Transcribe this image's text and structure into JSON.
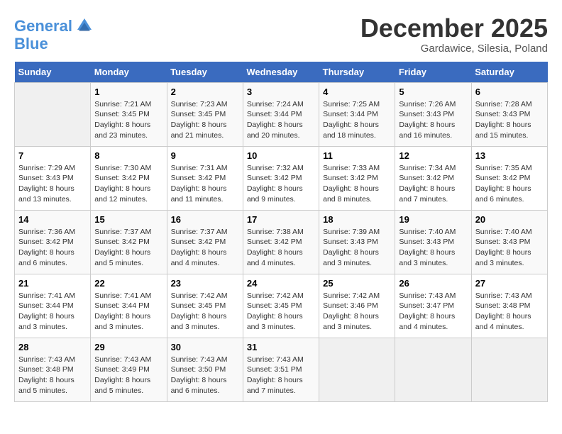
{
  "header": {
    "logo_line1": "General",
    "logo_line2": "Blue",
    "month": "December 2025",
    "location": "Gardawice, Silesia, Poland"
  },
  "weekdays": [
    "Sunday",
    "Monday",
    "Tuesday",
    "Wednesday",
    "Thursday",
    "Friday",
    "Saturday"
  ],
  "weeks": [
    [
      {
        "day": "",
        "info": ""
      },
      {
        "day": "1",
        "info": "Sunrise: 7:21 AM\nSunset: 3:45 PM\nDaylight: 8 hours\nand 23 minutes."
      },
      {
        "day": "2",
        "info": "Sunrise: 7:23 AM\nSunset: 3:45 PM\nDaylight: 8 hours\nand 21 minutes."
      },
      {
        "day": "3",
        "info": "Sunrise: 7:24 AM\nSunset: 3:44 PM\nDaylight: 8 hours\nand 20 minutes."
      },
      {
        "day": "4",
        "info": "Sunrise: 7:25 AM\nSunset: 3:44 PM\nDaylight: 8 hours\nand 18 minutes."
      },
      {
        "day": "5",
        "info": "Sunrise: 7:26 AM\nSunset: 3:43 PM\nDaylight: 8 hours\nand 16 minutes."
      },
      {
        "day": "6",
        "info": "Sunrise: 7:28 AM\nSunset: 3:43 PM\nDaylight: 8 hours\nand 15 minutes."
      }
    ],
    [
      {
        "day": "7",
        "info": "Sunrise: 7:29 AM\nSunset: 3:43 PM\nDaylight: 8 hours\nand 13 minutes."
      },
      {
        "day": "8",
        "info": "Sunrise: 7:30 AM\nSunset: 3:42 PM\nDaylight: 8 hours\nand 12 minutes."
      },
      {
        "day": "9",
        "info": "Sunrise: 7:31 AM\nSunset: 3:42 PM\nDaylight: 8 hours\nand 11 minutes."
      },
      {
        "day": "10",
        "info": "Sunrise: 7:32 AM\nSunset: 3:42 PM\nDaylight: 8 hours\nand 9 minutes."
      },
      {
        "day": "11",
        "info": "Sunrise: 7:33 AM\nSunset: 3:42 PM\nDaylight: 8 hours\nand 8 minutes."
      },
      {
        "day": "12",
        "info": "Sunrise: 7:34 AM\nSunset: 3:42 PM\nDaylight: 8 hours\nand 7 minutes."
      },
      {
        "day": "13",
        "info": "Sunrise: 7:35 AM\nSunset: 3:42 PM\nDaylight: 8 hours\nand 6 minutes."
      }
    ],
    [
      {
        "day": "14",
        "info": "Sunrise: 7:36 AM\nSunset: 3:42 PM\nDaylight: 8 hours\nand 6 minutes."
      },
      {
        "day": "15",
        "info": "Sunrise: 7:37 AM\nSunset: 3:42 PM\nDaylight: 8 hours\nand 5 minutes."
      },
      {
        "day": "16",
        "info": "Sunrise: 7:37 AM\nSunset: 3:42 PM\nDaylight: 8 hours\nand 4 minutes."
      },
      {
        "day": "17",
        "info": "Sunrise: 7:38 AM\nSunset: 3:42 PM\nDaylight: 8 hours\nand 4 minutes."
      },
      {
        "day": "18",
        "info": "Sunrise: 7:39 AM\nSunset: 3:43 PM\nDaylight: 8 hours\nand 3 minutes."
      },
      {
        "day": "19",
        "info": "Sunrise: 7:40 AM\nSunset: 3:43 PM\nDaylight: 8 hours\nand 3 minutes."
      },
      {
        "day": "20",
        "info": "Sunrise: 7:40 AM\nSunset: 3:43 PM\nDaylight: 8 hours\nand 3 minutes."
      }
    ],
    [
      {
        "day": "21",
        "info": "Sunrise: 7:41 AM\nSunset: 3:44 PM\nDaylight: 8 hours\nand 3 minutes."
      },
      {
        "day": "22",
        "info": "Sunrise: 7:41 AM\nSunset: 3:44 PM\nDaylight: 8 hours\nand 3 minutes."
      },
      {
        "day": "23",
        "info": "Sunrise: 7:42 AM\nSunset: 3:45 PM\nDaylight: 8 hours\nand 3 minutes."
      },
      {
        "day": "24",
        "info": "Sunrise: 7:42 AM\nSunset: 3:45 PM\nDaylight: 8 hours\nand 3 minutes."
      },
      {
        "day": "25",
        "info": "Sunrise: 7:42 AM\nSunset: 3:46 PM\nDaylight: 8 hours\nand 3 minutes."
      },
      {
        "day": "26",
        "info": "Sunrise: 7:43 AM\nSunset: 3:47 PM\nDaylight: 8 hours\nand 4 minutes."
      },
      {
        "day": "27",
        "info": "Sunrise: 7:43 AM\nSunset: 3:48 PM\nDaylight: 8 hours\nand 4 minutes."
      }
    ],
    [
      {
        "day": "28",
        "info": "Sunrise: 7:43 AM\nSunset: 3:48 PM\nDaylight: 8 hours\nand 5 minutes."
      },
      {
        "day": "29",
        "info": "Sunrise: 7:43 AM\nSunset: 3:49 PM\nDaylight: 8 hours\nand 5 minutes."
      },
      {
        "day": "30",
        "info": "Sunrise: 7:43 AM\nSunset: 3:50 PM\nDaylight: 8 hours\nand 6 minutes."
      },
      {
        "day": "31",
        "info": "Sunrise: 7:43 AM\nSunset: 3:51 PM\nDaylight: 8 hours\nand 7 minutes."
      },
      {
        "day": "",
        "info": ""
      },
      {
        "day": "",
        "info": ""
      },
      {
        "day": "",
        "info": ""
      }
    ]
  ]
}
